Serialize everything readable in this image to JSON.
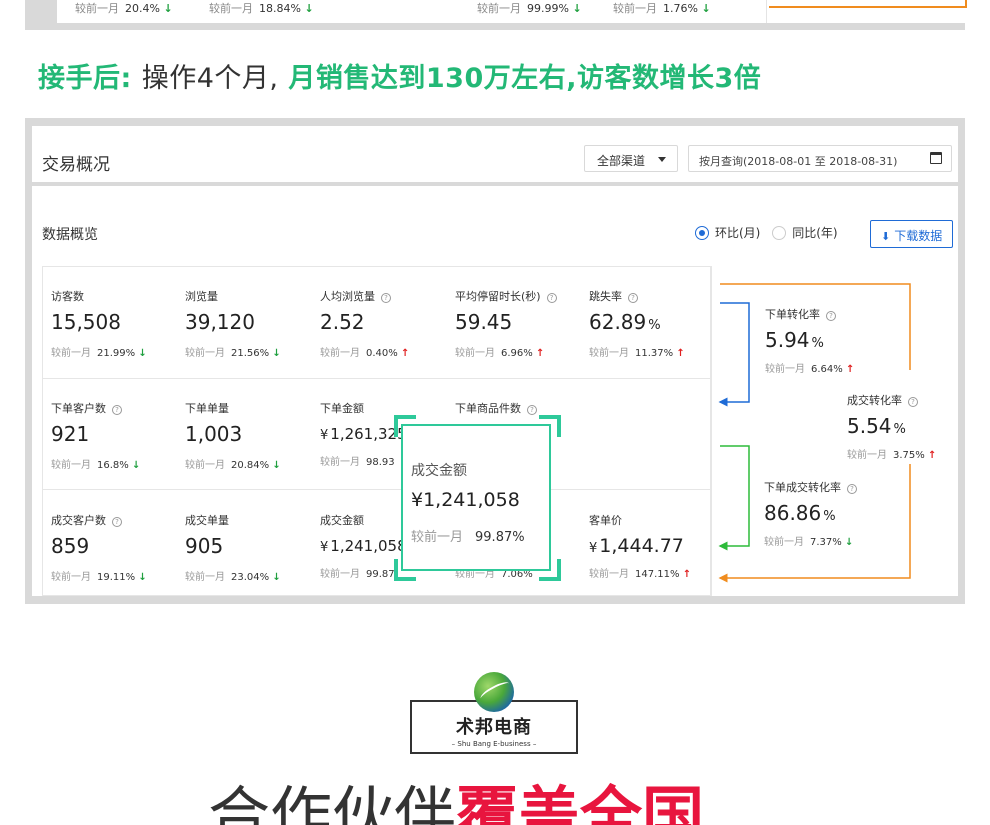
{
  "top_remnant": {
    "items": [
      {
        "label": "较前一月",
        "pct": "20.4%",
        "trend": "down"
      },
      {
        "label": "较前一月",
        "pct": "18.84%",
        "trend": "down"
      },
      {
        "label": "较前一月",
        "pct": "99.99%",
        "trend": "down"
      },
      {
        "label": "较前一月",
        "pct": "1.76%",
        "trend": "down"
      }
    ]
  },
  "headline": {
    "part1": "接手后:",
    "part2": "操作4个月,",
    "part3": "月销售达到130万左右,访客数增长3倍"
  },
  "header": {
    "title": "交易概况",
    "channel_select": "全部渠道",
    "date_range": "按月查询(2018-08-01 至 2018-08-31)"
  },
  "overview": {
    "title": "数据概览",
    "radio_month": "环比(月)",
    "radio_year": "同比(年)",
    "download_label": "下载数据"
  },
  "metrics": [
    {
      "label": "访客数",
      "value": "15,508",
      "cmp": "较前一月",
      "pct": "21.99%",
      "trend": "down",
      "help": false
    },
    {
      "label": "浏览量",
      "value": "39,120",
      "cmp": "较前一月",
      "pct": "21.56%",
      "trend": "down",
      "help": false
    },
    {
      "label": "人均浏览量",
      "value": "2.52",
      "cmp": "较前一月",
      "pct": "0.40%",
      "trend": "up",
      "help": true
    },
    {
      "label": "平均停留时长(秒)",
      "value": "59.45",
      "cmp": "较前一月",
      "pct": "6.96%",
      "trend": "up",
      "help": true
    },
    {
      "label": "跳失率",
      "value": "62.89",
      "unit": "%",
      "cmp": "较前一月",
      "pct": "11.37%",
      "trend": "up",
      "help": true
    },
    {
      "label": "下单客户数",
      "value": "921",
      "cmp": "较前一月",
      "pct": "16.8%",
      "trend": "down",
      "help": true
    },
    {
      "label": "下单单量",
      "value": "1,003",
      "cmp": "较前一月",
      "pct": "20.84%",
      "trend": "down",
      "help": false
    },
    {
      "label": "下单金额",
      "value": "1,261,325",
      "currency": "¥",
      "cmp": "较前一月",
      "pct": "98.93",
      "trend": "none",
      "help": false
    },
    {
      "label": "下单商品件数",
      "value": "",
      "cmp": "",
      "pct": "",
      "trend": "none",
      "help": true
    },
    {
      "label": "成交客户数",
      "value": "859",
      "cmp": "较前一月",
      "pct": "19.11%",
      "trend": "down",
      "help": true
    },
    {
      "label": "成交单量",
      "value": "905",
      "cmp": "较前一月",
      "pct": "23.04%",
      "trend": "down",
      "help": false
    },
    {
      "label": "成交金额",
      "value": "1,241,058",
      "currency": "¥",
      "cmp": "较前一月",
      "pct": "99.87",
      "trend": "none",
      "help": false
    },
    {
      "label": "",
      "value": "",
      "cmp": "较前一月",
      "pct": "7.06%",
      "trend": "none",
      "help": false
    },
    {
      "label": "客单价",
      "value": "1,444.77",
      "currency": "¥",
      "cmp": "较前一月",
      "pct": "147.11%",
      "trend": "up",
      "help": false
    }
  ],
  "funnel": {
    "order_conv": {
      "label": "下单转化率",
      "value": "5.94",
      "unit": "%",
      "cmp": "较前一月",
      "pct": "6.64%",
      "trend": "up"
    },
    "deal_conv": {
      "label": "成交转化率",
      "value": "5.54",
      "unit": "%",
      "cmp": "较前一月",
      "pct": "3.75%",
      "trend": "up"
    },
    "order_deal_conv": {
      "label": "下单成交转化率",
      "value": "86.86",
      "unit": "%",
      "cmp": "较前一月",
      "pct": "7.37%",
      "trend": "down"
    }
  },
  "zoom": {
    "label": "成交金额",
    "currency": "¥",
    "value": "1,241,058",
    "cmp": "较前一月",
    "pct": "99.87%"
  },
  "logo": {
    "name": "术邦电商",
    "sub": "– Shu Bang E-business –"
  },
  "bottom": {
    "text1": "合作伙伴",
    "text2": "覆盖全国"
  },
  "colors": {
    "green": "#23b876",
    "blue": "#1f6bd6",
    "orange": "#f08c1e",
    "funnel_green": "#2dbb3a",
    "up_red": "#e02020",
    "down_green": "#20a040",
    "zoom_border": "#2ec99a",
    "accent_red": "#e8153e"
  }
}
